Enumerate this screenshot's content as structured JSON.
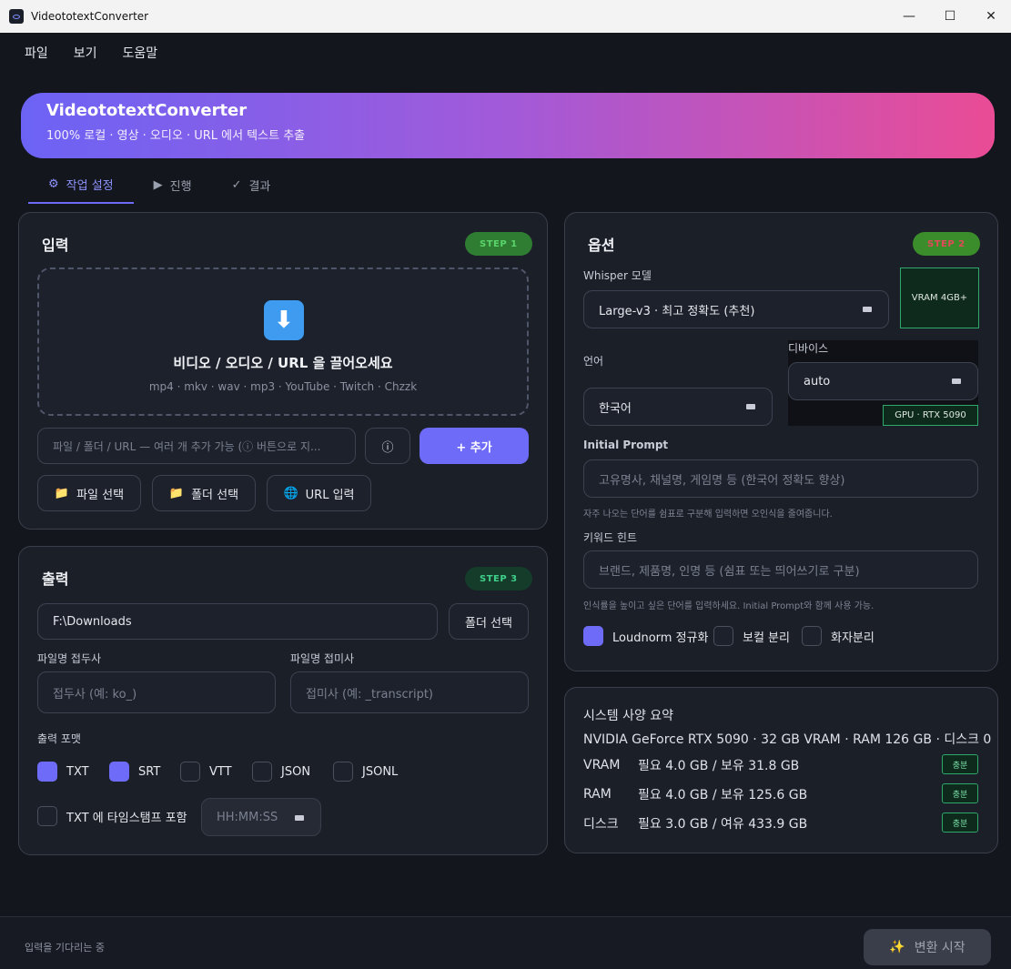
{
  "window": {
    "title": "VideototextConverter",
    "controls": [
      "—",
      "☐",
      "✕"
    ]
  },
  "menu": [
    "파일",
    "보기",
    "도움말"
  ],
  "banner": {
    "title": "VideototextConverter",
    "subtitle": "100% 로컬 · 영상 · 오디오 · URL 에서 텍스트 추출"
  },
  "tabs": [
    {
      "label": "작업 설정",
      "icon": "gear-icon",
      "glyph": "⚙",
      "active": true
    },
    {
      "label": "진행",
      "icon": "play-icon",
      "glyph": "▶",
      "active": false
    },
    {
      "label": "결과",
      "icon": "check-icon",
      "glyph": "✓",
      "active": false
    }
  ],
  "input": {
    "title": "입력",
    "step": "STEP 1",
    "step_color": "#2f7d32",
    "dropzone": {
      "icon": "download-arrow-icon",
      "title": "비디오 / 오디오 / URL 을 끌어오세요",
      "formats": "mp4 · mkv · wav · mp3 · YouTube · Twitch · Chzzk"
    },
    "path_placeholder": "파일 / 폴더 / URL — 여러 개 추가 가능 (ⓘ 버튼으로 지...",
    "info_glyph": "ⓘ",
    "add_label": "+  추가",
    "buttons": [
      {
        "label": "파일 선택",
        "icon": "folder-icon",
        "glyph": "📁"
      },
      {
        "label": "폴더 선택",
        "icon": "folder-icon",
        "glyph": "📁"
      },
      {
        "label": "URL 입력",
        "icon": "globe-icon",
        "glyph": "🌐"
      }
    ]
  },
  "output": {
    "title": "출력",
    "step": "STEP 3",
    "step_color": "#1e8c5a",
    "folder_value": "F:\\Downloads",
    "folder_button": "폴더 선택",
    "prefix_label": "파일명 접두사",
    "prefix_placeholder": "접두사 (예: ko_)",
    "suffix_label": "파일명 접미사",
    "suffix_placeholder": "접미사 (예: _transcript)",
    "format_label": "출력 포맷",
    "formats": [
      {
        "label": "TXT",
        "checked": true
      },
      {
        "label": "SRT",
        "checked": true
      },
      {
        "label": "VTT",
        "checked": false
      },
      {
        "label": "JSON",
        "checked": false
      },
      {
        "label": "JSONL",
        "checked": false
      }
    ],
    "timestamp_label": "TXT 에 타임스탬프 포함",
    "timestamp_checked": false,
    "timestamp_format": "HH:MM:SS"
  },
  "options": {
    "title": "옵션",
    "step": "STEP 2",
    "step_color": "#3b8c2a",
    "model_label": "Whisper 모델",
    "model_value": "Large-v3 · 최고 정확도 (추천)",
    "vram_badge": "VRAM 4GB+",
    "language_label": "언어",
    "language_value": "한국어",
    "device_label": "디바이스",
    "device_value": "auto",
    "gpu_badge": "GPU · RTX 5090",
    "prompt_label": "Initial Prompt",
    "prompt_placeholder": "고유명사, 채널명, 게임명 등 (한국어 정확도 향상)",
    "prompt_hint": "자주 나오는 단어를 쉼표로 구분해 입력하면 오인식을 줄여줍니다.",
    "keyword_label": "키워드 힌트",
    "keyword_placeholder": "브랜드, 제품명, 인명 등 (쉼표 또는 띄어쓰기로 구분)",
    "keyword_hint": "인식률을 높이고 싶은 단어를 입력하세요. Initial Prompt와 함께 사용 가능.",
    "toggles": [
      {
        "label": "Loudnorm 정규화",
        "checked": true
      },
      {
        "label": "보컬 분리",
        "checked": false
      },
      {
        "label": "화자분리",
        "checked": false
      }
    ]
  },
  "system": {
    "title": "시스템 사양 요약",
    "summary": "NVIDIA GeForce RTX 5090 · 32 GB VRAM · RAM 126 GB · 디스크 0",
    "rows": [
      {
        "key": "VRAM",
        "value": "필요 4.0 GB / 보유 31.8 GB",
        "status": "충분"
      },
      {
        "key": "RAM",
        "value": "필요 4.0 GB / 보유 125.6 GB",
        "status": "충분"
      },
      {
        "key": "디스크",
        "value": "필요 3.0 GB / 여유 433.9 GB",
        "status": "충분"
      }
    ]
  },
  "footer": {
    "status": "입력을 기다리는 중",
    "start_label": "변환 시작",
    "start_icon": "sparkle-icon",
    "start_glyph": "✨"
  }
}
